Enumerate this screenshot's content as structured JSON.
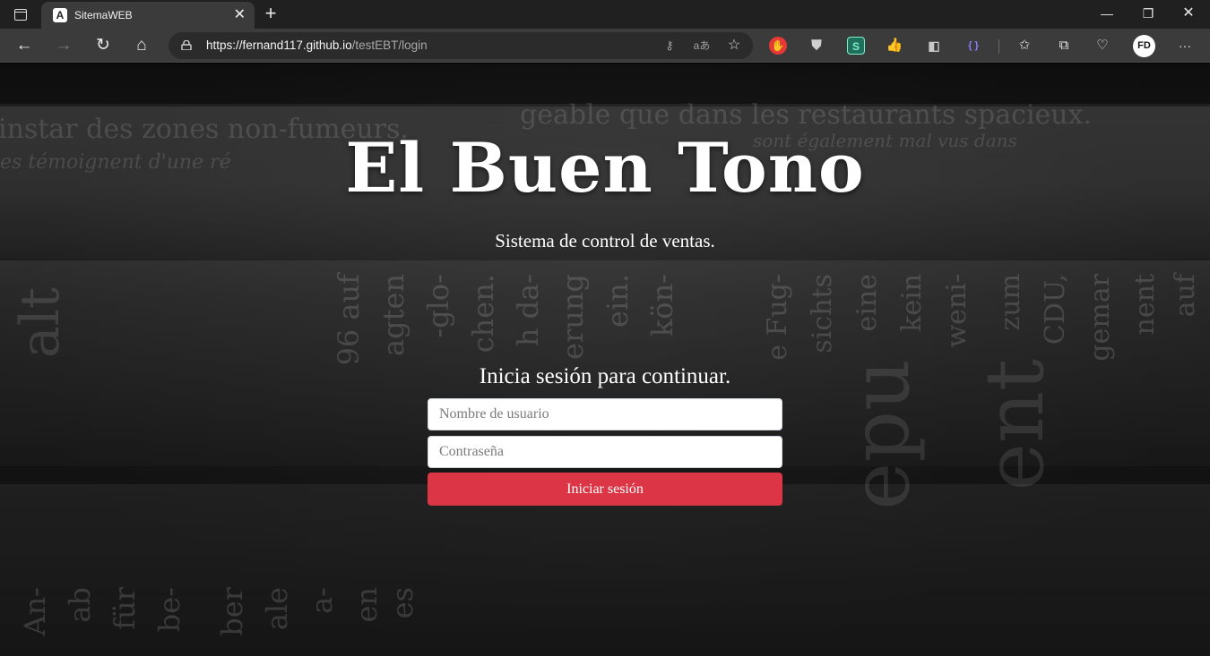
{
  "browser": {
    "tab": {
      "favicon": "A",
      "title": "SitemaWEB",
      "close": "✕"
    },
    "new_tab": "+",
    "window_controls": {
      "minimize": "—",
      "restore": "❐",
      "close": "✕"
    },
    "nav": {
      "back": "←",
      "forward": "→",
      "reload": "↻",
      "home": "⌂"
    },
    "url": {
      "scheme": "https://",
      "host": "fernand117.github.io",
      "path": "/testEBT/login"
    },
    "address_icons": [
      "key-icon",
      "read-aloud-icon",
      "add-favorite-icon"
    ],
    "extensions": [
      "adblock-extension-icon",
      "shield-extension-icon",
      "s-extension-icon",
      "thumb-extension-icon",
      "cookie-extension-icon",
      "braces-extension-icon"
    ],
    "extension_labels": {
      "s": "S",
      "braces": "{ }"
    },
    "toolbar_icons": [
      "favorites-icon",
      "collections-icon",
      "browser-essentials-icon"
    ],
    "profile_initials": "FD",
    "more": "···"
  },
  "page": {
    "brand": "El Buen Tono",
    "tagline": "Sistema de control de ventas.",
    "login": {
      "heading": "Inicia sesión para continuar.",
      "username_placeholder": "Nombre de usuario",
      "password_placeholder": "Contraseña",
      "submit_label": "Iniciar sesión"
    },
    "colors": {
      "primary_button": "#dc3545",
      "background": "#1f1f1f"
    }
  }
}
